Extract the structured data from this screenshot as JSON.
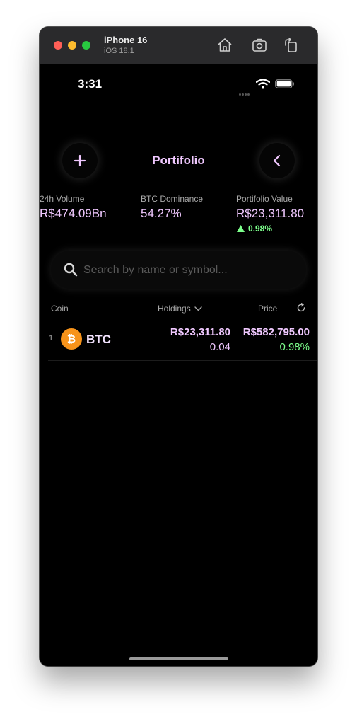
{
  "simulator": {
    "device_name": "iPhone 16",
    "os_version": "iOS 18.1"
  },
  "status_bar": {
    "time": "3:31"
  },
  "nav": {
    "title": "Portifolio",
    "left_icon": "plus-icon",
    "right_icon": "chevron-left-icon"
  },
  "stats": [
    {
      "label": "24h Volume",
      "value": "R$474.09Bn"
    },
    {
      "label": "BTC Dominance",
      "value": "54.27%"
    },
    {
      "label": "Portifolio Value",
      "value": "R$23,311.80",
      "change": "0.98%",
      "change_direction": "up"
    }
  ],
  "search": {
    "placeholder": "Search by name or symbol..."
  },
  "columns": {
    "coin": "Coin",
    "holdings": "Holdings",
    "price": "Price"
  },
  "coins": [
    {
      "rank": "1",
      "symbol": "BTC",
      "holdings_value": "R$23,311.80",
      "holdings_quantity": "0.04",
      "price": "R$582,795.00",
      "price_change": "0.98%"
    }
  ],
  "colors": {
    "accent": "#f0c8ff",
    "positive": "#7dff8c",
    "btc": "#f7931a",
    "background": "#000000"
  }
}
